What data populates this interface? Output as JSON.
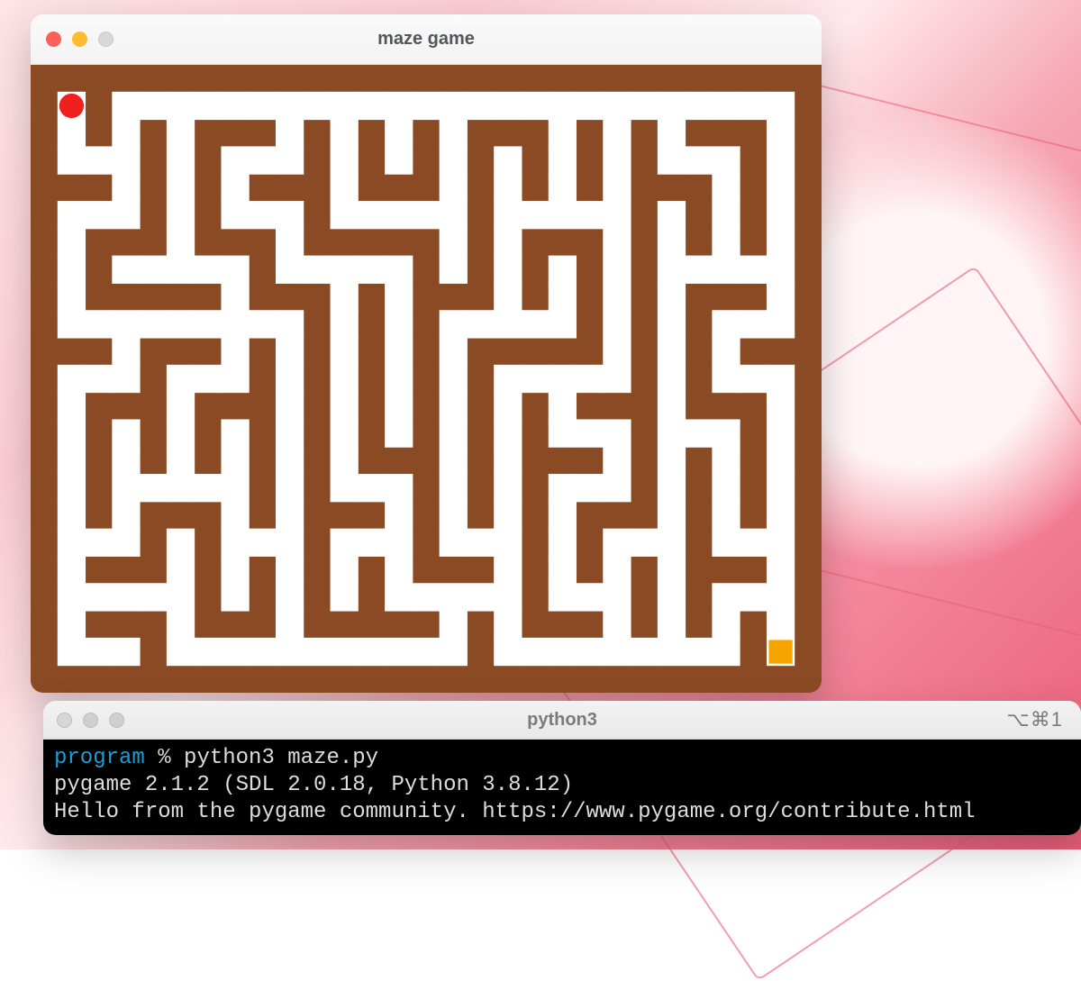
{
  "game_window": {
    "title": "maze game",
    "traffic_lights": {
      "close": "close-icon",
      "minimize": "minimize-icon",
      "zoom": "zoom-icon"
    },
    "maze": {
      "cols": 29,
      "rows": 22,
      "wall_color": "#8a4a24",
      "path_color": "#ffffff",
      "player_color": "#ef1f1f",
      "goal_color": "#f6a500",
      "player_cell": [
        1,
        1
      ],
      "goal_cell": [
        27,
        21
      ],
      "rows_data": [
        "#############################",
        "#.#.........................#",
        "#.#.#.###.#.#.#.###.#.#.###.#",
        "#...#.#...#.#.#.#.#.#.#...#.#",
        "###.#.#.###.###.#.#.#.###.#.#",
        "#...#.#...#.....#.....#.#.#.#",
        "#.###.###.#####.#.###.#.#.#.#",
        "#.#.....#.....#.#.#.#.#.....#",
        "#.#####.###.#.###.#.#.#.###.#",
        "#.........#.#.#.....#.#.#...#",
        "###.###.#.#.#.#.#####.#.#.###",
        "#...#...#.#.#.#.#.....#.#...#",
        "#.###.###.#.#.#.#.#.###.###.#",
        "#.#.#.#.#.#.#.#.#.#...#...#.#",
        "#.#.#.#.#.#.###.#.###.#.#.#.#",
        "#.#.....#.#...#.#.#...#.#.#.#",
        "#.#.###.#.###.#.#.#.###.#.#.#",
        "#...#.#...#...#...#.#...#...#",
        "#.###.#.#.#.#.###.#.#.#.###.#",
        "#.....#.#.#.#.....#...#.#...#",
        "#.###.###.#####.#.###.#.#.#.#",
        "#...#...........#.........#.#",
        "#############################"
      ]
    }
  },
  "terminal_window": {
    "title": "python3",
    "shortcut_hint": "⌥⌘1",
    "prompt": {
      "dir": "program",
      "sep": "%",
      "cmd": "python3 maze.py"
    },
    "output_lines": [
      "pygame 2.1.2 (SDL 2.0.18, Python 3.8.12)",
      "Hello from the pygame community. https://www.pygame.org/contribute.html"
    ]
  }
}
